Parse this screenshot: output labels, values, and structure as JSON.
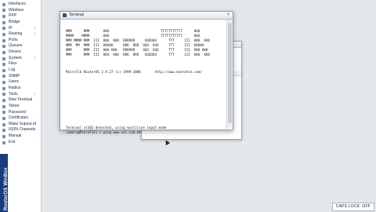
{
  "sidebar": {
    "items": [
      {
        "label": "Interfaces",
        "submenu": false
      },
      {
        "label": "Wireless",
        "submenu": false
      },
      {
        "label": "PPP",
        "submenu": false
      },
      {
        "label": "Bridge",
        "submenu": false
      },
      {
        "label": "IP",
        "submenu": true
      },
      {
        "label": "Routing",
        "submenu": true
      },
      {
        "label": "Ports",
        "submenu": false
      },
      {
        "label": "Queues",
        "submenu": false
      },
      {
        "label": "Drivers",
        "submenu": false
      },
      {
        "label": "System",
        "submenu": true
      },
      {
        "label": "Files",
        "submenu": false
      },
      {
        "label": "Log",
        "submenu": false
      },
      {
        "label": "SNMP",
        "submenu": false
      },
      {
        "label": "Users",
        "submenu": false
      },
      {
        "label": "Radius",
        "submenu": false
      },
      {
        "label": "Tools",
        "submenu": true
      },
      {
        "label": "New Terminal",
        "submenu": false
      },
      {
        "label": "Telnet",
        "submenu": false
      },
      {
        "label": "Password",
        "submenu": false
      },
      {
        "label": "Certificates",
        "submenu": false
      },
      {
        "label": "Make Supout.rif",
        "submenu": false
      },
      {
        "label": "ISDN Channels",
        "submenu": false
      },
      {
        "label": "Manual",
        "submenu": false
      },
      {
        "label": "Exit",
        "submenu": false
      }
    ],
    "submenu_arrow": "›",
    "brand": "RouterOS WinBox"
  },
  "terminal": {
    "title": "Terminal",
    "close_glyph": "×",
    "ascii_banner": "MMM      MMM       KKK                          TTTTTTTTTTT      KKK\nMMMM    MMMM       KKK                          TTTTTTTTTTT      KKK\nMMM MMMM MMM  III  KKK  KKK  RRRRRR     OOOOOO      TTT     III  KKK  KKK\nMMM  MM  MMM  III  KKKKK     RRR  RRR  OOO  OOO     TTT     III  KKKKK\nMMM      MMM  III  KKK KKK   RRRRRR    OOO  OOO     TTT     III  KKK KKK\nMMM      MMM  III  KKK  KKK  RRR  RRR   OOOOOO      TTT     III  KKK  KKK",
    "version_line": "MikroTik RouterOS 2.9.27 (c) 1999-2006       http://www.mikrotik.com/",
    "notice_line": "Terminal vt102 detected, using multiline input mode",
    "prompt_line": "[admin@MikroTik] > ping www.sol.com.mt"
  },
  "status": {
    "caps_lock": "CAPS LOCK: OFF"
  },
  "colors": {
    "brand_blue": "#1a3c7a",
    "desktop": "#e4e7eb"
  }
}
